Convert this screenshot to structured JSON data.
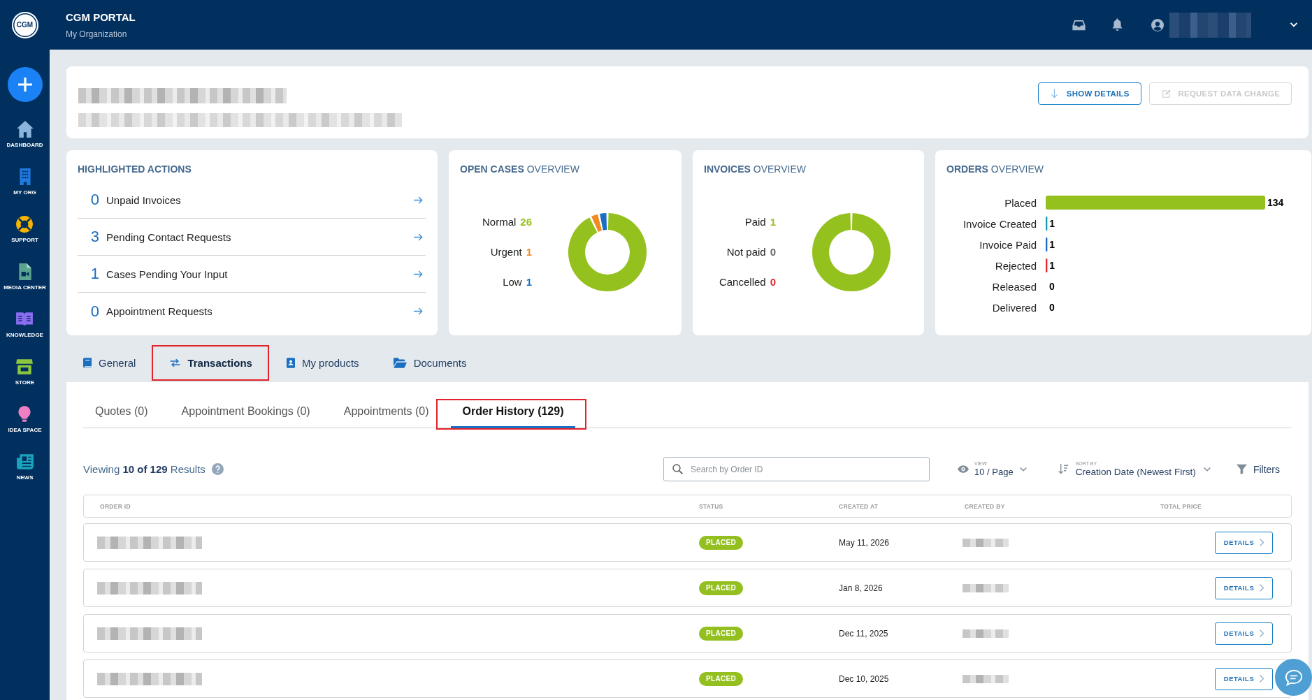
{
  "topbar": {
    "logo": "CGM",
    "title": "CGM PORTAL",
    "subtitle": "My Organization"
  },
  "sidebar": {
    "items": [
      {
        "label": "DASHBOARD"
      },
      {
        "label": "MY ORG"
      },
      {
        "label": "SUPPORT"
      },
      {
        "label": "MEDIA CENTER"
      },
      {
        "label": "KNOWLEDGE"
      },
      {
        "label": "STORE"
      },
      {
        "label": "IDEA SPACE"
      },
      {
        "label": "NEWS"
      }
    ]
  },
  "header_card": {
    "buttons": [
      {
        "label": "SHOW DETAILS",
        "disabled": false
      },
      {
        "label": "REQUEST DATA CHANGE",
        "disabled": true
      }
    ]
  },
  "highlighted_actions": {
    "title": "HIGHLIGHTED ACTIONS",
    "items": [
      {
        "count": "0",
        "label": "Unpaid Invoices"
      },
      {
        "count": "3",
        "label": "Pending Contact Requests"
      },
      {
        "count": "1",
        "label": "Cases Pending Your Input"
      },
      {
        "count": "0",
        "label": "Appointment Requests"
      }
    ]
  },
  "open_cases": {
    "title": "**OPEN CASES** OVERVIEW",
    "legend": [
      {
        "label": "Normal",
        "value": "26",
        "color": "#95c11f"
      },
      {
        "label": "Urgent",
        "value": "1",
        "color": "#f08a24"
      },
      {
        "label": "Low",
        "value": "1",
        "color": "#1a6fc0"
      }
    ]
  },
  "invoices": {
    "title": "**INVOICES** OVERVIEW",
    "legend": [
      {
        "label": "Paid",
        "value": "1",
        "color": "#95c11f"
      },
      {
        "label": "Not paid",
        "value": "0",
        "color": "#666666"
      },
      {
        "label": "Cancelled",
        "value": "0",
        "color": "#e3262f"
      }
    ]
  },
  "orders": {
    "title": "**ORDERS** OVERVIEW",
    "chart_data": {
      "type": "bar",
      "orientation": "horizontal",
      "categories": [
        "Placed",
        "Invoice Created",
        "Invoice Paid",
        "Rejected",
        "Released",
        "Delivered"
      ],
      "values": [
        134,
        1,
        1,
        1,
        0,
        0
      ],
      "colors": [
        "#95c11f",
        "#1a9bb0",
        "#1a6fc0",
        "#e3262f",
        null,
        null
      ],
      "data_labels": true
    }
  },
  "tabs": [
    {
      "label": "General",
      "selected": false,
      "highlighted": false
    },
    {
      "label": "Transactions",
      "selected": true,
      "highlighted": true
    },
    {
      "label": "My products",
      "selected": false,
      "highlighted": false
    },
    {
      "label": "Documents",
      "selected": false,
      "highlighted": false
    }
  ],
  "subtabs": [
    {
      "label": "Quotes (0)",
      "selected": false,
      "highlighted": false
    },
    {
      "label": "Appointment Bookings (0)",
      "selected": false,
      "highlighted": false
    },
    {
      "label": "Appointments (0)",
      "selected": false,
      "highlighted": false
    },
    {
      "label": "Order History (129)",
      "selected": true,
      "highlighted": true
    }
  ],
  "toolbar": {
    "results": "Viewing **10 of 129** Results",
    "search": {
      "placeholder": "Search by Order ID"
    },
    "view": {
      "label": "VIEW",
      "value": "10 / Page"
    },
    "sort": {
      "label": "SORT BY",
      "value": "Creation Date (Newest First)"
    },
    "filters": "Filters"
  },
  "table": {
    "columns": [
      "ORDER ID",
      "STATUS",
      "CREATED AT",
      "CREATED BY",
      "TOTAL PRICE"
    ],
    "rows": [
      {
        "status": "PLACED",
        "created_at": "May 11, 2026",
        "action": "DETAILS"
      },
      {
        "status": "PLACED",
        "created_at": "Jan 8, 2026",
        "action": "DETAILS"
      },
      {
        "status": "PLACED",
        "created_at": "Dec 11, 2025",
        "action": "DETAILS"
      },
      {
        "status": "PLACED",
        "created_at": "Dec 10, 2025",
        "action": "DETAILS"
      }
    ]
  }
}
